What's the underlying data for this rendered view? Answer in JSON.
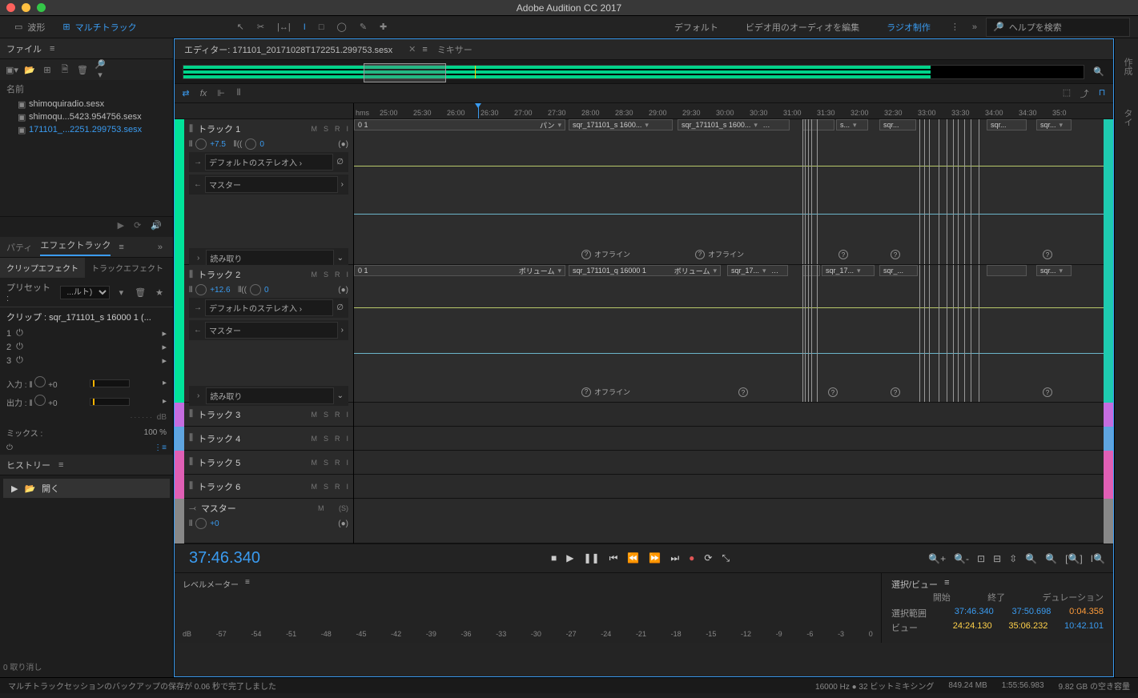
{
  "app": {
    "title": "Adobe Audition CC 2017"
  },
  "views": {
    "waveform": "波形",
    "multitrack": "マルチトラック"
  },
  "workspaces": {
    "default": "デフォルト",
    "video": "ビデオ用のオーディオを編集",
    "radio": "ラジオ制作"
  },
  "search": {
    "placeholder": "ヘルプを検索"
  },
  "files": {
    "panel_title": "ファイル",
    "col_name": "名前",
    "items": [
      "shimoquiradio.sesx",
      "shimoqu...5423.954756.sesx",
      "171101_...2251.299753.sesx"
    ]
  },
  "effectrack": {
    "panel_title_left": "パティ",
    "panel_title": "エフェクトラック",
    "tab_clip": "クリップエフェクト",
    "tab_track": "トラックエフェクト",
    "preset_label": "プリセット :",
    "preset_value": "...ルト)",
    "clip_label": "クリップ : sqr_171101_s 16000 1 (...",
    "slots": [
      "1",
      "2",
      "3"
    ],
    "input": "入力 :",
    "output": "出力 :",
    "io_val": "+0",
    "mix_label": "ミックス :",
    "mix_value": "100 %",
    "db": "dB"
  },
  "right_tabs": {
    "create": "作成",
    "type": "タイ"
  },
  "history": {
    "title": "ヒストリー",
    "open": "開く",
    "undo": "0 取り消し"
  },
  "editor": {
    "title_prefix": "エディター:",
    "filename": "171101_20171028T172251.299753.sesx",
    "mixer": "ミキサー",
    "ruler_hms": "hms",
    "ruler_ticks": [
      "25:00",
      "25:30",
      "26:00",
      "26:30",
      "27:00",
      "27:30",
      "28:00",
      "28:30",
      "29:00",
      "29:30",
      "30:00",
      "30:30",
      "31:00",
      "31:30",
      "32:00",
      "32:30",
      "33:00",
      "33:30",
      "34:00",
      "34:30",
      "35:0"
    ]
  },
  "tracks": {
    "t1": {
      "name": "トラック 1",
      "vol": "+7.5",
      "pan": "0",
      "input": "デフォルトのステレオ入",
      "output": "マスター",
      "read": "読み取り",
      "lane_label_r": "パン",
      "clip1": "sqr_171101_s 1600...",
      "clip2": "sqr_171101_s 1600...",
      "clip3": "s...",
      "clip4": "sqr...",
      "clip5": "sqr...",
      "offline": "オフライン"
    },
    "t2": {
      "name": "トラック 2",
      "vol": "+12.6",
      "pan": "0",
      "input": "デフォルトのステレオ入",
      "output": "マスター",
      "read": "読み取り",
      "lane_label_r": "ボリューム",
      "clip1": "sqr_171101_q 16000 1",
      "clip1_r": "ボリューム",
      "clip2": "sqr_17...",
      "clip3": "sqr_17...",
      "clip4": "sqr_...",
      "clip5": "sqr...",
      "offline": "オフライン"
    },
    "t3": {
      "name": "トラック 3"
    },
    "t4": {
      "name": "トラック 4"
    },
    "t5": {
      "name": "トラック 5"
    },
    "t6": {
      "name": "トラック 6"
    },
    "master": {
      "name": "マスター",
      "vol": "+0"
    },
    "msr": {
      "m": "M",
      "s": "S",
      "r": "R",
      "i": "I",
      "sp": "(S)"
    },
    "lane_row_label": "0 1"
  },
  "transport": {
    "time": "37:46.340"
  },
  "level": {
    "title": "レベルメーター",
    "scale": [
      "dB",
      "-57",
      "-54",
      "-51",
      "-48",
      "-45",
      "-42",
      "-39",
      "-36",
      "-33",
      "-30",
      "-27",
      "-24",
      "-21",
      "-18",
      "-15",
      "-12",
      "-9",
      "-6",
      "-3",
      "0"
    ]
  },
  "selection": {
    "title": "選択/ビュー",
    "col_start": "開始",
    "col_end": "終了",
    "col_dur": "デュレーション",
    "sel_label": "選択範囲",
    "sel_start": "37:46.340",
    "sel_end": "37:50.698",
    "sel_dur": "0:04.358",
    "view_label": "ビュー",
    "view_start": "24:24.130",
    "view_end": "35:06.232",
    "view_dur": "10:42.101"
  },
  "status": {
    "msg": "マルチトラックセッションのバックアップの保存が 0.06 秒で完了しました",
    "format": "16000 Hz ● 32 ビットミキシング",
    "mem": "849.24 MB",
    "dur": "1:55:56.983",
    "disk": "9.82 GB の空き容量"
  }
}
